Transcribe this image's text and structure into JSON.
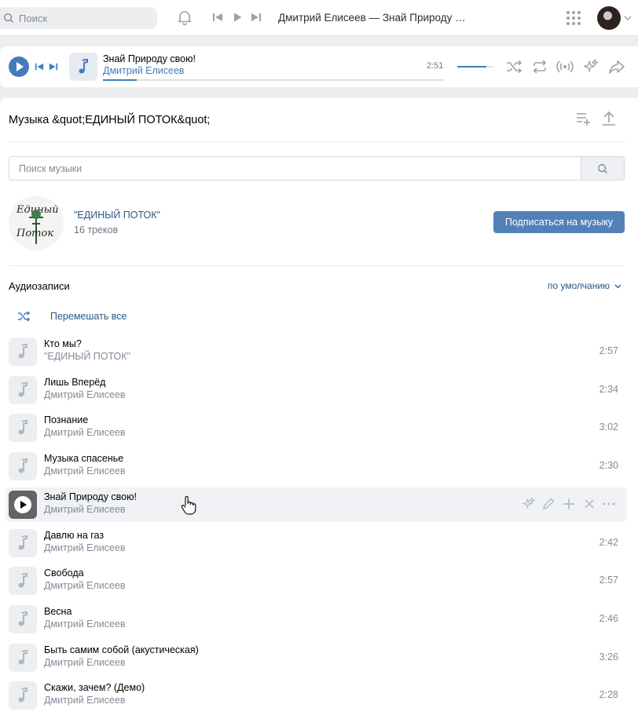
{
  "header": {
    "search_placeholder": "Поиск",
    "now_playing": "Дмитрий Елисеев — Знай Природу свою!"
  },
  "player": {
    "title": "Знай Природу свою!",
    "artist": "Дмитрий Елисеев",
    "time": "2:51",
    "progress": 0.1,
    "volume": 0.8
  },
  "page": {
    "title": "Музыка &quot;ЕДИНЫЙ ПОТОК&quot;",
    "search_placeholder": "Поиск музыки"
  },
  "playlist": {
    "name": "\"ЕДИНЫЙ ПОТОК\"",
    "count": "16 треков",
    "subscribe_label": "Подписаться на музыку",
    "cover_text": [
      "Единый",
      "Поток"
    ]
  },
  "audio": {
    "section_title": "Аудиозаписи",
    "sort_label": "по умолчанию",
    "shuffle_label": "Перемешать все",
    "tracks": [
      {
        "title": "Кто мы?",
        "artist": "\"ЕДИНЫЙ ПОТОК\"",
        "duration": "2:57"
      },
      {
        "title": "Лишь Вперёд",
        "artist": "Дмитрий Елисеев",
        "duration": "2:34"
      },
      {
        "title": "Познание",
        "artist": "Дмитрий Елисеев",
        "duration": "3:02"
      },
      {
        "title": "Музыка спасенье",
        "artist": "Дмитрий Елисеев",
        "duration": "2:30"
      },
      {
        "title": "Знай Природу свою!",
        "artist": "Дмитрий Елисеев",
        "duration": ""
      },
      {
        "title": "Давлю на газ",
        "artist": "Дмитрий Елисеев",
        "duration": "2:42"
      },
      {
        "title": "Свобода",
        "artist": "Дмитрий Елисеев",
        "duration": "2:57"
      },
      {
        "title": "Весна",
        "artist": "Дмитрий Елисеев",
        "duration": "2:46"
      },
      {
        "title": "Быть самим собой (акустическая)",
        "artist": "Дмитрий Елисеев",
        "duration": "3:26"
      },
      {
        "title": "Скажи, зачем? (Демо)",
        "artist": "Дмитрий Елисеев",
        "duration": "2:28"
      }
    ]
  },
  "colors": {
    "accent": "#447bba",
    "link": "#2a5885",
    "button": "#5181b8",
    "muted": "#818c99",
    "page_bg": "#edeef0"
  },
  "icons": [
    "search-icon",
    "bell-icon",
    "prev-icon",
    "play-icon",
    "next-icon",
    "apps-icon",
    "music-note-icon",
    "shuffle-icon",
    "repeat-icon",
    "broadcast-icon",
    "sparkle-icon",
    "share-icon",
    "add-playlist-icon",
    "upload-icon",
    "edit-icon",
    "plus-icon",
    "close-icon",
    "more-icon",
    "chevron-down-icon",
    "hand-cursor-icon"
  ]
}
